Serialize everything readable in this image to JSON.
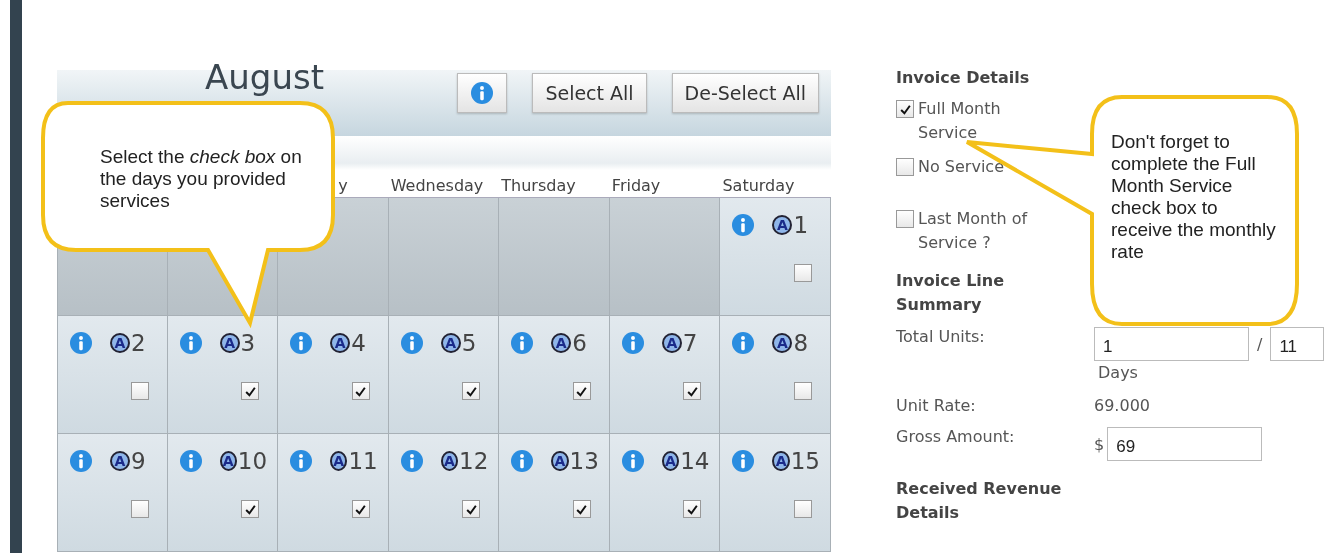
{
  "calendar": {
    "month": "August",
    "buttons": [
      {
        "kind": "info"
      },
      {
        "kind": "text",
        "label": "Select All"
      },
      {
        "kind": "text",
        "label": "De-Select All"
      }
    ],
    "weekdays": [
      {
        "kind": "hidden"
      },
      {
        "kind": "hidden"
      },
      {
        "kind": "label",
        "label": "y"
      },
      {
        "kind": "label",
        "label": "Wednesday"
      },
      {
        "kind": "label",
        "label": "Thursday"
      },
      {
        "kind": "label",
        "label": "Friday"
      },
      {
        "kind": "label",
        "label": "Saturday"
      }
    ],
    "weeks": [
      [
        {
          "kind": "empty"
        },
        {
          "kind": "empty"
        },
        {
          "kind": "empty"
        },
        {
          "kind": "empty"
        },
        {
          "kind": "empty"
        },
        {
          "kind": "empty"
        },
        {
          "kind": "day",
          "day": "1",
          "badge": "A",
          "checked": false
        }
      ],
      [
        {
          "kind": "day",
          "day": "2",
          "badge": "A",
          "checked": false
        },
        {
          "kind": "day",
          "day": "3",
          "badge": "A",
          "checked": true
        },
        {
          "kind": "day",
          "day": "4",
          "badge": "A",
          "checked": true
        },
        {
          "kind": "day",
          "day": "5",
          "badge": "A",
          "checked": true
        },
        {
          "kind": "day",
          "day": "6",
          "badge": "A",
          "checked": true
        },
        {
          "kind": "day",
          "day": "7",
          "badge": "A",
          "checked": true
        },
        {
          "kind": "day",
          "day": "8",
          "badge": "A",
          "checked": false
        }
      ],
      [
        {
          "kind": "day",
          "day": "9",
          "badge": "A",
          "checked": false
        },
        {
          "kind": "day",
          "day": "10",
          "badge": "A",
          "checked": true
        },
        {
          "kind": "day",
          "day": "11",
          "badge": "A",
          "checked": true
        },
        {
          "kind": "day",
          "day": "12",
          "badge": "A",
          "checked": true
        },
        {
          "kind": "day",
          "day": "13",
          "badge": "A",
          "checked": true
        },
        {
          "kind": "day",
          "day": "14",
          "badge": "A",
          "checked": true
        },
        {
          "kind": "day",
          "day": "15",
          "badge": "A",
          "checked": false
        }
      ]
    ]
  },
  "invoice_details": {
    "title": "Invoice Details",
    "options": [
      {
        "label": "Full Month Service",
        "checked": true
      },
      {
        "label": "No Service",
        "checked": false
      },
      {
        "label": "Last Month of Service ?",
        "checked": false
      }
    ]
  },
  "invoice_line_summary": {
    "title": "Invoice Line Summary",
    "total_units_label": "Total Units:",
    "total_units_value": "1",
    "separator": "/",
    "total_units_max": "11",
    "units_caption": "Days",
    "unit_rate_label": "Unit Rate:",
    "unit_rate_value": "69.000",
    "gross_amount_label": "Gross Amount:",
    "currency": "$",
    "gross_amount_value": "69"
  },
  "received_revenue": {
    "title": "Received Revenue Details"
  },
  "callouts": [
    {
      "text": "Select the *check box* on the days you provided services"
    },
    {
      "text": "Don't forget to complete the Full Month Service check box to receive the monthly rate"
    }
  ]
}
